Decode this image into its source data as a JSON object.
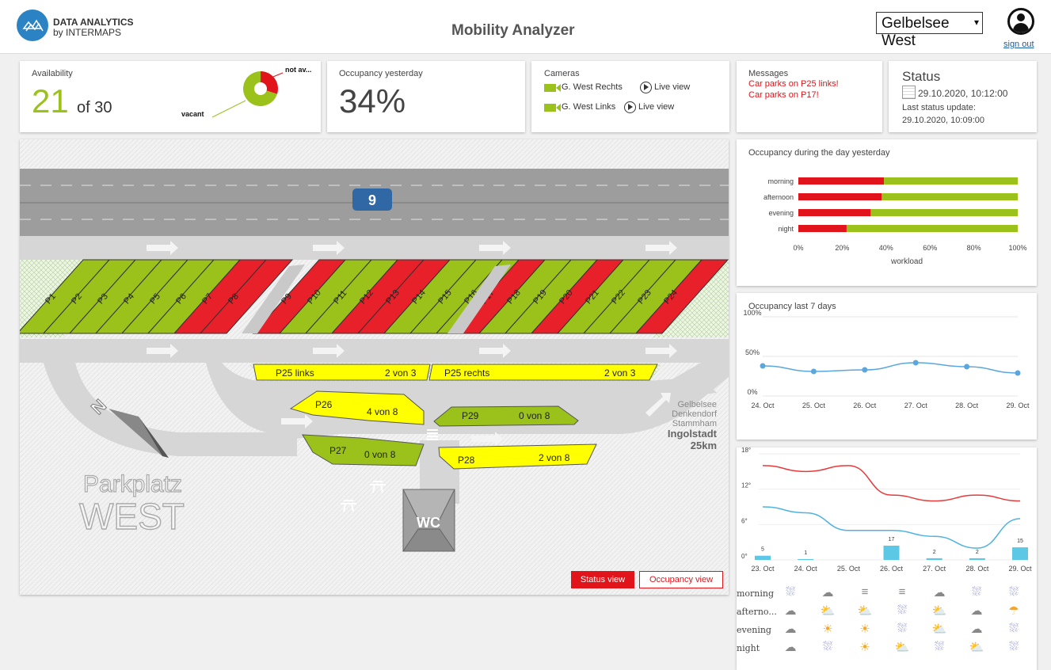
{
  "header": {
    "brand_line1": "DATA ANALYTICS",
    "brand_line2": "by INTERMAPS",
    "title": "Mobility Analyzer",
    "location_selected": "Gelbelsee West",
    "sign_out": "sign out"
  },
  "availability": {
    "label": "Availability",
    "value": "21",
    "of_text": "of 30",
    "pie_label_not": "not av...",
    "pie_label_vacant": "vacant",
    "vacant_fraction": 0.7,
    "colors": {
      "vacant": "#9ac21b",
      "not_available": "#e1141b"
    }
  },
  "occupancy_yesterday": {
    "label": "Occupancy yesterday",
    "value": "34%"
  },
  "cameras": {
    "label": "Cameras",
    "items": [
      {
        "name": "G. West Rechts",
        "action": "Live view"
      },
      {
        "name": "G. West Links",
        "action": "Live view"
      }
    ]
  },
  "messages": {
    "label": "Messages",
    "items": [
      "Car parks on P25 links!",
      "Car parks on P17!"
    ]
  },
  "status": {
    "label": "Status",
    "datetime": "29.10.2020, 10:12:00",
    "last_update_label": "Last status update:",
    "last_update": "29.10.2020, 10:09:00"
  },
  "map": {
    "road_number": "9",
    "spots": [
      "P1",
      "P2",
      "P3",
      "P4",
      "P5",
      "P6",
      "P7",
      "P8",
      "P9",
      "P10",
      "P11",
      "P12",
      "P13",
      "P14",
      "P15",
      "P16",
      "P17",
      "P18",
      "P19",
      "P20",
      "P21",
      "P22",
      "P23",
      "P24"
    ],
    "occupied_spots": [
      "P7",
      "P8",
      "P9",
      "P12",
      "P13",
      "P17",
      "P20",
      "P24"
    ],
    "zones": [
      {
        "name": "P25 links",
        "count": "2 von 3"
      },
      {
        "name": "P25 rechts",
        "count": "2 von 3"
      },
      {
        "name": "P26",
        "count": "4 von 8"
      },
      {
        "name": "P29",
        "count": "0 von 8"
      },
      {
        "name": "P27",
        "count": "0 von 8"
      },
      {
        "name": "P28",
        "count": "2 von 8"
      }
    ],
    "direction_lines": [
      "Gelbelsee",
      "Denkendorf",
      "Stammham"
    ],
    "direction_city": "Ingolstadt",
    "direction_distance": "25km",
    "lot_name_line1": "Parkplatz",
    "lot_name_line2": "WEST",
    "wc": "WC",
    "btn_status": "Status view",
    "btn_occupancy": "Occupancy view"
  },
  "chart_data": [
    {
      "type": "bar",
      "title": "Occupancy during the day yesterday",
      "xlabel": "workload",
      "categories": [
        "morning",
        "afternoon",
        "evening",
        "night"
      ],
      "series": [
        {
          "values": [
            39,
            38,
            33,
            22
          ],
          "color": "#e1141b"
        },
        {
          "values": [
            61,
            62,
            67,
            78
          ],
          "color": "#9ac21b"
        }
      ],
      "xlim": [
        0,
        100
      ],
      "ticks": [
        "0%",
        "20%",
        "40%",
        "60%",
        "80%",
        "100%"
      ]
    },
    {
      "type": "line",
      "title": "Occupancy last 7 days",
      "x": [
        "24. Oct",
        "25. Oct",
        "26. Oct",
        "27. Oct",
        "28. Oct",
        "29. Oct"
      ],
      "values": [
        38,
        31,
        33,
        42,
        37,
        29
      ],
      "ylim": [
        0,
        100
      ],
      "yticks": [
        "0%",
        "50%",
        "100%"
      ]
    },
    {
      "type": "line",
      "x": [
        "23. Oct",
        "24. Oct",
        "25. Oct",
        "26. Oct",
        "27. Oct",
        "28. Oct",
        "29. Oct"
      ],
      "series": [
        {
          "values": [
            16,
            15,
            16,
            11,
            10,
            11,
            10
          ],
          "color": "#e83a3a"
        },
        {
          "values": [
            9,
            8,
            5,
            5,
            4,
            2,
            7
          ],
          "color": "#4fb3e0"
        }
      ],
      "bars": [
        5,
        1,
        0,
        17,
        2,
        2,
        15
      ],
      "bar_labels": [
        "5",
        "1",
        "",
        "17",
        "2",
        "2",
        "15"
      ],
      "ylim": [
        0,
        18
      ],
      "yticks": [
        "0°",
        "6°",
        "12°",
        "18°"
      ]
    }
  ],
  "weather_table": {
    "rows": [
      {
        "label": "morning",
        "icons": [
          "rain",
          "cloud",
          "fog",
          "fog",
          "cloud",
          "rain",
          "rain"
        ]
      },
      {
        "label": "afterno...",
        "icons": [
          "cloud",
          "sun-cloud",
          "sun-cloud",
          "rain",
          "sun-cloud",
          "cloud",
          "sun-rain"
        ]
      },
      {
        "label": "evening",
        "icons": [
          "cloud",
          "sun",
          "sun",
          "rain",
          "sun-cloud",
          "cloud",
          "rain"
        ]
      },
      {
        "label": "night",
        "icons": [
          "cloud",
          "rain",
          "sun",
          "sun-cloud",
          "rain",
          "sun-cloud",
          "rain"
        ]
      }
    ]
  }
}
